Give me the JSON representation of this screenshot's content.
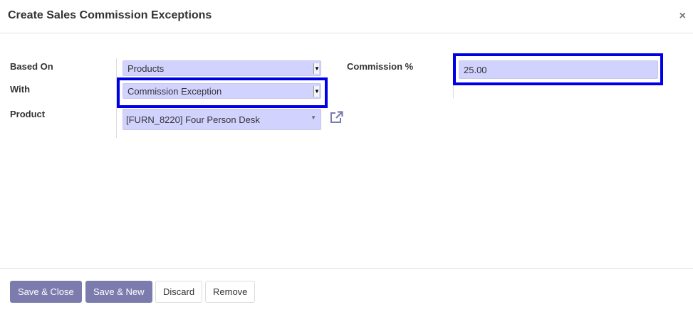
{
  "dialog": {
    "title": "Create Sales Commission Exceptions",
    "close": "×"
  },
  "form": {
    "based_on": {
      "label": "Based On",
      "value": "Products"
    },
    "with": {
      "label": "With",
      "value": "Commission Exception"
    },
    "product": {
      "label": "Product",
      "value": "[FURN_8220] Four Person Desk"
    },
    "commission": {
      "label": "Commission %",
      "value": "25.00"
    }
  },
  "footer": {
    "save_close": "Save & Close",
    "save_new": "Save & New",
    "discard": "Discard",
    "remove": "Remove"
  },
  "colors": {
    "primary": "#7c7bad",
    "field": "#d2d2ff",
    "highlight": "#0000e6"
  }
}
